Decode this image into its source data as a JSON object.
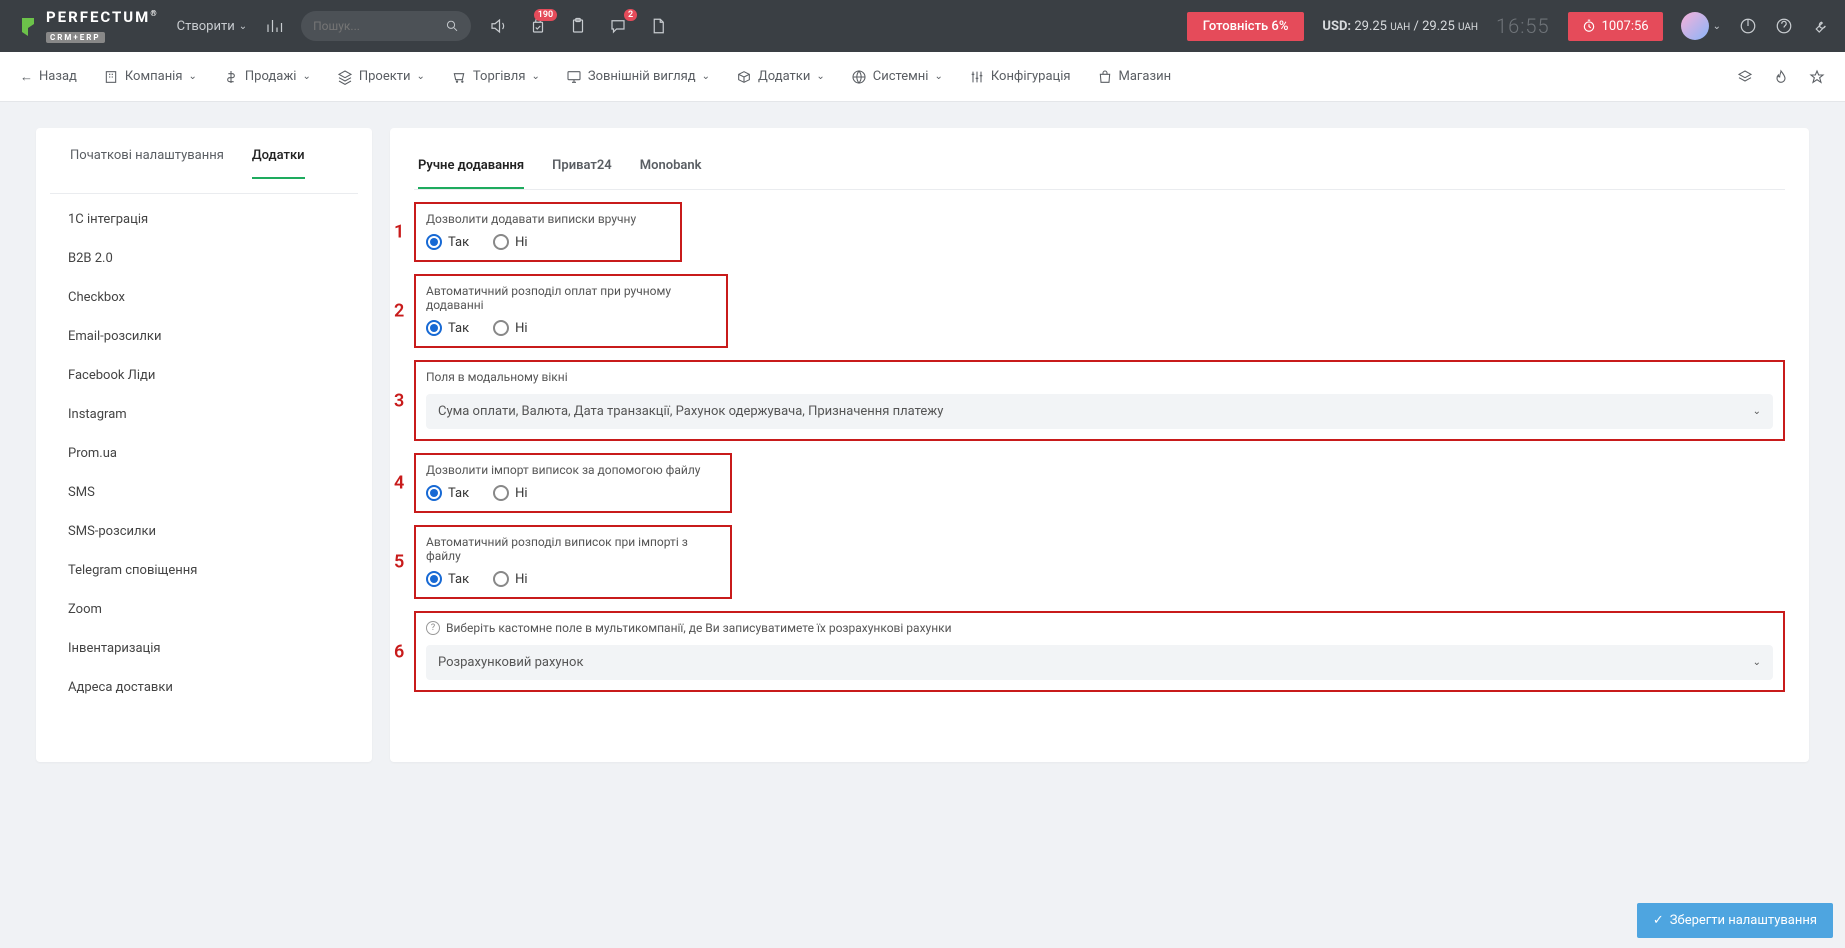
{
  "topbar": {
    "logo_text": "PERFECTUM",
    "logo_sub": "CRM+ERP",
    "create_label": "Створити",
    "search_placeholder": "Пошук...",
    "badge_cart": "190",
    "badge_chat": "2",
    "readiness_label": "Готовність 6%",
    "usd_prefix": "USD:",
    "usd_rate1": "29.25",
    "usd_rate2": "29.25",
    "uah_label": "UAH",
    "slash": " / ",
    "clock": "16:55",
    "timer": "1007:56"
  },
  "navbar": {
    "back": "Назад",
    "items": [
      "Компанія",
      "Продажі",
      "Проекти",
      "Торгівля",
      "Зовнішній вигляд",
      "Додатки",
      "Системні",
      "Конфігурація",
      "Магазин"
    ]
  },
  "sidebar": {
    "tabs": [
      "Початкові налаштування",
      "Додатки"
    ],
    "items": [
      "1С інтеграція",
      "B2B 2.0",
      "Checkbox",
      "Email-розсилки",
      "Facebook Ліди",
      "Instagram",
      "Prom.ua",
      "SMS",
      "SMS-розсилки",
      "Telegram сповіщення",
      "Zoom",
      "Інвентаризація",
      "Адреса доставки"
    ]
  },
  "content": {
    "tabs": [
      "Ручне додавання",
      "Приват24",
      "Monobank"
    ],
    "yes": "Так",
    "no": "Ні",
    "fields": {
      "f1_label": "Дозволити додавати виписки вручну",
      "f2_label": "Автоматичний розподіл оплат при ручному додаванні",
      "f3_label": "Поля в модальному вікні",
      "f3_value": "Сума оплати, Валюта, Дата транзакції, Рахунок одержувача, Призначення платежу",
      "f4_label": "Дозволити імпорт виписок за допомогою файлу",
      "f5_label": "Автоматичний розподіл виписок при імпорті з файлу",
      "f6_label": "Виберіть кастомне поле в мультикомпанії, де Ви записуватимете їх розрахункові рахунки",
      "f6_value": "Розрахунковий рахунок"
    },
    "nums": [
      "1",
      "2",
      "3",
      "4",
      "5",
      "6"
    ]
  },
  "footer": {
    "save": "Зберегти налаштування"
  }
}
